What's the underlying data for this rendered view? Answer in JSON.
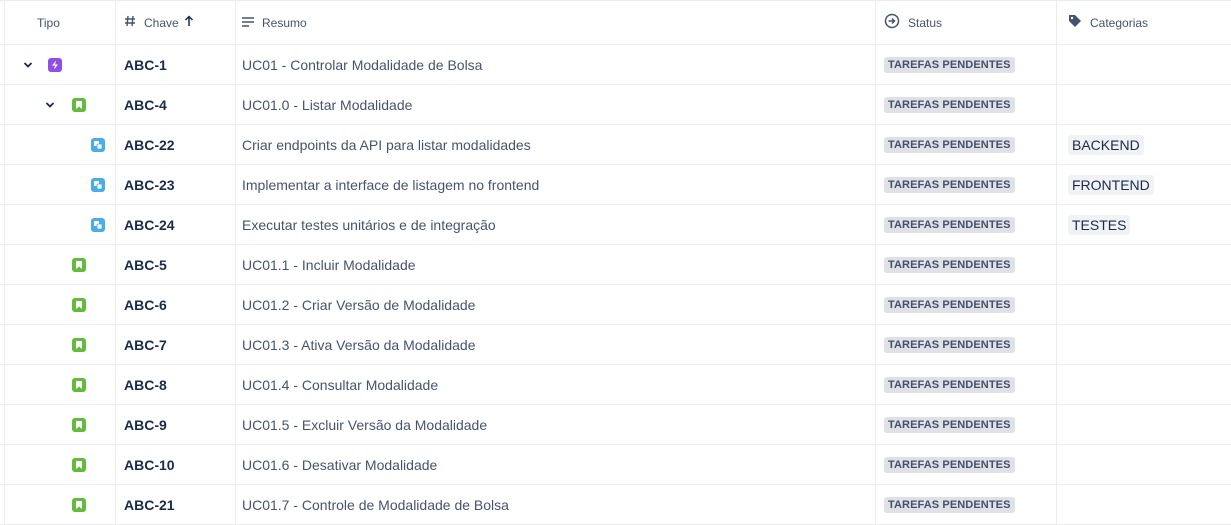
{
  "header": {
    "tipo": "Tipo",
    "chave": "Chave",
    "resumo": "Resumo",
    "status": "Status",
    "categorias": "Categorias"
  },
  "rows": [
    {
      "type": "epic",
      "expanded": true,
      "level": 0,
      "key": "ABC-1",
      "summary": "UC01 - Controlar Modalidade de Bolsa",
      "status": "TAREFAS PENDENTES",
      "category": ""
    },
    {
      "type": "story",
      "expanded": true,
      "level": 1,
      "key": "ABC-4",
      "summary": "UC01.0 - Listar Modalidade",
      "status": "TAREFAS PENDENTES",
      "category": ""
    },
    {
      "type": "subtask",
      "level": 2,
      "key": "ABC-22",
      "summary": "Criar endpoints da API para listar modalidades",
      "status": "TAREFAS PENDENTES",
      "category": "BACKEND"
    },
    {
      "type": "subtask",
      "level": 2,
      "key": "ABC-23",
      "summary": "Implementar a interface de listagem no frontend",
      "status": "TAREFAS PENDENTES",
      "category": "FRONTEND"
    },
    {
      "type": "subtask",
      "level": 2,
      "key": "ABC-24",
      "summary": "Executar testes unitários e de integração",
      "status": "TAREFAS PENDENTES",
      "category": "TESTES"
    },
    {
      "type": "story",
      "level": 1,
      "key": "ABC-5",
      "summary": "UC01.1 - Incluir Modalidade",
      "status": "TAREFAS PENDENTES",
      "category": ""
    },
    {
      "type": "story",
      "level": 1,
      "key": "ABC-6",
      "summary": "UC01.2 - Criar Versão de Modalidade",
      "status": "TAREFAS PENDENTES",
      "category": ""
    },
    {
      "type": "story",
      "level": 1,
      "key": "ABC-7",
      "summary": "UC01.3 - Ativa Versão da Modalidade",
      "status": "TAREFAS PENDENTES",
      "category": ""
    },
    {
      "type": "story",
      "level": 1,
      "key": "ABC-8",
      "summary": "UC01.4 - Consultar Modalidade",
      "status": "TAREFAS PENDENTES",
      "category": ""
    },
    {
      "type": "story",
      "level": 1,
      "key": "ABC-9",
      "summary": "UC01.5 - Excluir Versão da Modalidade",
      "status": "TAREFAS PENDENTES",
      "category": ""
    },
    {
      "type": "story",
      "level": 1,
      "key": "ABC-10",
      "summary": "UC01.6 - Desativar Modalidade",
      "status": "TAREFAS PENDENTES",
      "category": ""
    },
    {
      "type": "story",
      "level": 1,
      "key": "ABC-21",
      "summary": "UC01.7 - Controle de Modalidade de Bolsa",
      "status": "TAREFAS PENDENTES",
      "category": ""
    }
  ],
  "icons": {
    "epic": "lightning-bolt-icon",
    "story": "bookmark-icon",
    "subtask": "subtask-icon",
    "chave": "hash-icon",
    "resumo": "lines-icon",
    "status": "circle-arrow-icon",
    "categorias": "tag-icon",
    "sort": "arrow-up-icon"
  },
  "colors": {
    "epic": "#904ee2",
    "story": "#63ba3c",
    "subtask": "#4bade8",
    "lozenge_bg": "#dfe1e6",
    "lozenge_text": "#42526e",
    "tag_bg": "#f1f2f4"
  }
}
